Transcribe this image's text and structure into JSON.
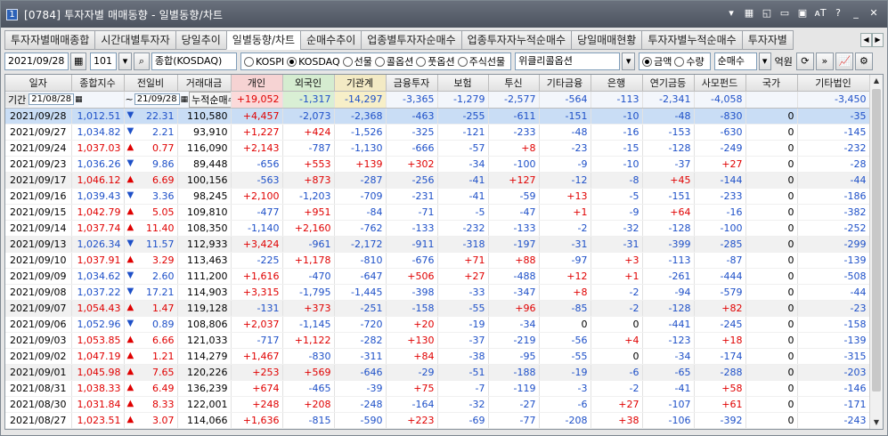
{
  "window": {
    "screen_no": "1",
    "title": "[0784] 투자자별 매매동향 - 일별동향/차트"
  },
  "tabs": [
    "투자자별매매종합",
    "시간대별투자자",
    "당일추이",
    "일별동향/차트",
    "순매수추이",
    "업종별투자자순매수",
    "업종투자자누적순매수",
    "당일매매현황",
    "투자자별누적순매수",
    "투자자별"
  ],
  "active_tab": 3,
  "controls": {
    "date": "2021/09/28",
    "code": "101",
    "market": "종합(KOSDAQ)",
    "radios": [
      {
        "label": "KOSPI",
        "on": false
      },
      {
        "label": "KOSDAQ",
        "on": true
      },
      {
        "label": "선물",
        "on": false
      },
      {
        "label": "콜옵션",
        "on": false
      },
      {
        "label": "풋옵션",
        "on": false
      },
      {
        "label": "주식선물",
        "on": false
      }
    ],
    "option_select": "위클리콜옵션",
    "unit_radios": [
      {
        "label": "금액",
        "on": true
      },
      {
        "label": "수량",
        "on": false
      }
    ],
    "mode_select": "순매수",
    "unit": "억원"
  },
  "summary": {
    "label_period": "기간",
    "from": "21/08/28",
    "to": "21/09/28",
    "label_cum": "누적순매수",
    "values": [
      "+19,052",
      "-1,317",
      "-14,297",
      "-3,365",
      "-1,279",
      "-2,577",
      "-564",
      "-113",
      "-2,341",
      "-4,058",
      "",
      "-3,450"
    ]
  },
  "columns": [
    "일자",
    "종합지수",
    "전일비",
    "거래대금",
    "개인",
    "외국인",
    "기관계",
    "금융투자",
    "보험",
    "투신",
    "기타금융",
    "은행",
    "연기금등",
    "사모펀드",
    "국가",
    "기타법인"
  ],
  "rows": [
    [
      "2021/09/28",
      "1,012.51",
      "dn",
      "22.31",
      "110,580",
      "+4,457",
      "-2,073",
      "-2,368",
      "-463",
      "-255",
      "-611",
      "-151",
      "-10",
      "-48",
      "-830",
      "0",
      "-35"
    ],
    [
      "2021/09/27",
      "1,034.82",
      "dn",
      "2.21",
      "93,910",
      "+1,227",
      "+424",
      "-1,526",
      "-325",
      "-121",
      "-233",
      "-48",
      "-16",
      "-153",
      "-630",
      "0",
      "-145"
    ],
    [
      "2021/09/24",
      "1,037.03",
      "up",
      "0.77",
      "116,090",
      "+2,143",
      "-787",
      "-1,130",
      "-666",
      "-57",
      "+8",
      "-23",
      "-15",
      "-128",
      "-249",
      "0",
      "-232"
    ],
    [
      "2021/09/23",
      "1,036.26",
      "dn",
      "9.86",
      "89,448",
      "-656",
      "+553",
      "+139",
      "+302",
      "-34",
      "-100",
      "-9",
      "-10",
      "-37",
      "+27",
      "0",
      "-28"
    ],
    [
      "2021/09/17",
      "1,046.12",
      "up",
      "6.69",
      "100,156",
      "-563",
      "+873",
      "-287",
      "-256",
      "-41",
      "+127",
      "-12",
      "-8",
      "+45",
      "-144",
      "0",
      "-44"
    ],
    [
      "2021/09/16",
      "1,039.43",
      "dn",
      "3.36",
      "98,245",
      "+2,100",
      "-1,203",
      "-709",
      "-231",
      "-41",
      "-59",
      "+13",
      "-5",
      "-151",
      "-233",
      "0",
      "-186"
    ],
    [
      "2021/09/15",
      "1,042.79",
      "up",
      "5.05",
      "109,810",
      "-477",
      "+951",
      "-84",
      "-71",
      "-5",
      "-47",
      "+1",
      "-9",
      "+64",
      "-16",
      "0",
      "-382"
    ],
    [
      "2021/09/14",
      "1,037.74",
      "up",
      "11.40",
      "108,350",
      "-1,140",
      "+2,160",
      "-762",
      "-133",
      "-232",
      "-133",
      "-2",
      "-32",
      "-128",
      "-100",
      "0",
      "-252"
    ],
    [
      "2021/09/13",
      "1,026.34",
      "dn",
      "11.57",
      "112,933",
      "+3,424",
      "-961",
      "-2,172",
      "-911",
      "-318",
      "-197",
      "-31",
      "-31",
      "-399",
      "-285",
      "0",
      "-299"
    ],
    [
      "2021/09/10",
      "1,037.91",
      "up",
      "3.29",
      "113,463",
      "-225",
      "+1,178",
      "-810",
      "-676",
      "+71",
      "+88",
      "-97",
      "+3",
      "-113",
      "-87",
      "0",
      "-139"
    ],
    [
      "2021/09/09",
      "1,034.62",
      "dn",
      "2.60",
      "111,200",
      "+1,616",
      "-470",
      "-647",
      "+506",
      "+27",
      "-488",
      "+12",
      "+1",
      "-261",
      "-444",
      "0",
      "-508"
    ],
    [
      "2021/09/08",
      "1,037.22",
      "dn",
      "17.21",
      "114,903",
      "+3,315",
      "-1,795",
      "-1,445",
      "-398",
      "-33",
      "-347",
      "+8",
      "-2",
      "-94",
      "-579",
      "0",
      "-44"
    ],
    [
      "2021/09/07",
      "1,054.43",
      "up",
      "1.47",
      "119,128",
      "-131",
      "+373",
      "-251",
      "-158",
      "-55",
      "+96",
      "-85",
      "-2",
      "-128",
      "+82",
      "0",
      "-23"
    ],
    [
      "2021/09/06",
      "1,052.96",
      "dn",
      "0.89",
      "108,806",
      "+2,037",
      "-1,145",
      "-720",
      "+20",
      "-19",
      "-34",
      "0",
      "0",
      "-441",
      "-245",
      "0",
      "-158"
    ],
    [
      "2021/09/03",
      "1,053.85",
      "up",
      "6.66",
      "121,033",
      "-717",
      "+1,122",
      "-282",
      "+130",
      "-37",
      "-219",
      "-56",
      "+4",
      "-123",
      "+18",
      "0",
      "-139"
    ],
    [
      "2021/09/02",
      "1,047.19",
      "up",
      "1.21",
      "114,279",
      "+1,467",
      "-830",
      "-311",
      "+84",
      "-38",
      "-95",
      "-55",
      "0",
      "-34",
      "-174",
      "0",
      "-315"
    ],
    [
      "2021/09/01",
      "1,045.98",
      "up",
      "7.65",
      "120,226",
      "+253",
      "+569",
      "-646",
      "-29",
      "-51",
      "-188",
      "-19",
      "-6",
      "-65",
      "-288",
      "0",
      "-203"
    ],
    [
      "2021/08/31",
      "1,038.33",
      "up",
      "6.49",
      "136,239",
      "+674",
      "-465",
      "-39",
      "+75",
      "-7",
      "-119",
      "-3",
      "-2",
      "-41",
      "+58",
      "0",
      "-146"
    ],
    [
      "2021/08/30",
      "1,031.84",
      "up",
      "8.33",
      "122,001",
      "+248",
      "+208",
      "-248",
      "-164",
      "-32",
      "-27",
      "-6",
      "+27",
      "-107",
      "+61",
      "0",
      "-171"
    ],
    [
      "2021/08/27",
      "1,023.51",
      "up",
      "3.07",
      "114,066",
      "+1,636",
      "-815",
      "-590",
      "+223",
      "-69",
      "-77",
      "-208",
      "+38",
      "-106",
      "-392",
      "0",
      "-243"
    ]
  ]
}
